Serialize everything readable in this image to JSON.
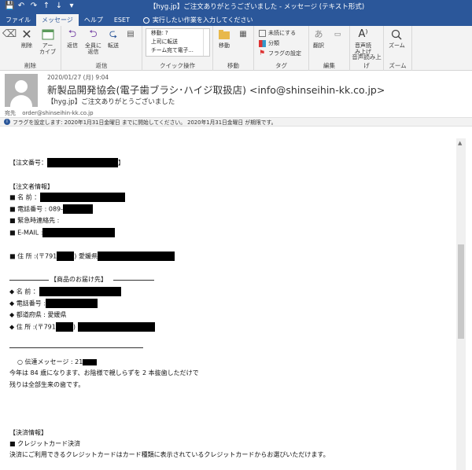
{
  "titlebar": {
    "title": "【hyg.jp】ご注文ありがとうございました  -  メッセージ (テキスト形式)"
  },
  "tabs": {
    "items": [
      "ファイル",
      "メッセージ",
      "ヘルプ",
      "ESET"
    ],
    "active": "メッセージ",
    "tellme": "実行したい作業を入力してください"
  },
  "ribbon": {
    "delete_group": {
      "label": "削除",
      "delete": "削除",
      "archive": "アー\nカイブ"
    },
    "respond_group": {
      "label": "返信",
      "reply": "返信",
      "reply_all": "全員に\n返信",
      "forward": "転送"
    },
    "quick_group": {
      "label": "クイック操作",
      "items": [
        "移動: ?",
        "上司に転送",
        "チーム宛て電子..."
      ]
    },
    "move_group": {
      "label": "移動",
      "move": "移動"
    },
    "tags_group": {
      "label": "タグ",
      "items": [
        "未読にする",
        "分類",
        "フラグの設定"
      ]
    },
    "edit_group": {
      "label": "編集",
      "translate": "翻訳"
    },
    "speech_group": {
      "label": "音声読み上げ",
      "read": "音声読\nみ上げ"
    },
    "zoom_group": {
      "label": "ズーム",
      "zoom": "ズーム"
    }
  },
  "header": {
    "date": "2020/01/27 (月) 9:04",
    "sender": "新製品開発協会(電子歯ブラシ･ハイジ取扱店) <info@shinseihin-kk.co.jp>",
    "subject": "【hyg.jp】ご注文ありがとうございました",
    "to_label": "宛先",
    "to": "order@shinseihin-kk.co.jp",
    "flag_notice": "フラグを設定します: 2020年1月31日金曜日 までに開始してください。 2020年1月31日金曜日 が期限です。"
  },
  "body": {
    "order_no": "【注文番号：",
    "order_no_end": "】",
    "orderer_info": "【注文者情報】",
    "name": "■ 名 前 ：",
    "tel": "■ 電話番号 : 089-",
    "emergency": "■ 緊急時連絡先 :",
    "email": "■ E-MAIL :",
    "address": "■ 住 所 :(〒791",
    "address_pref": ") 愛媛県",
    "delivery_head": "【商品のお届け先】",
    "d_name": "◆ 名 前 ：",
    "d_tel": "◆ 電話番号 :",
    "d_pref": "◆ 都道府県 : 愛媛県",
    "d_address": "◆ 住 所 :(〒791",
    "d_address_end": ")",
    "message_label": "○ 伝達メッセージ : 21",
    "message1": "今年は 84 歳になります、お陰様で親しらずを 2 本抜歯しただけで",
    "message2": "残りは全部生来の歯です。",
    "payment_head": "【決済情報】",
    "payment_method": "■ クレジットカード決済",
    "payment_note": "決済にご利用できるクレジットカードはカード種類に表示されているクレジットカードからお選びいただけます。"
  },
  "colors": {
    "accent": "#2b579a",
    "ribbon_bg": "#f3f3f3"
  }
}
